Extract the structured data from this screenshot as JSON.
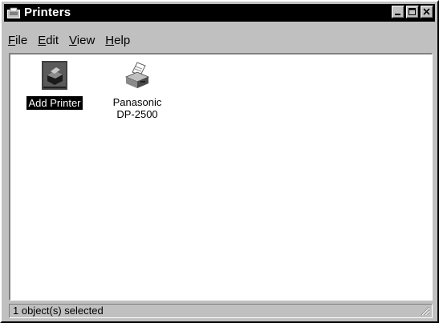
{
  "window": {
    "title": "Printers",
    "controls": {
      "minimize_icon": "minimize-icon",
      "maximize_icon": "maximize-icon",
      "close_icon": "close-icon"
    }
  },
  "menu": {
    "items": [
      {
        "label": "File",
        "accel": "F"
      },
      {
        "label": "Edit",
        "accel": "E"
      },
      {
        "label": "View",
        "accel": "V"
      },
      {
        "label": "Help",
        "accel": "H"
      }
    ]
  },
  "icons": [
    {
      "label": "Add Printer",
      "icon": "add-printer-icon",
      "selected": true
    },
    {
      "label_line1": "Panasonic",
      "label_line2": "DP-2500",
      "icon": "printer-icon",
      "selected": false
    }
  ],
  "status": {
    "text": "1 object(s) selected"
  },
  "colors": {
    "titlebar": "#000000",
    "desktop_gray": "#c0c0c0",
    "client_bg": "#ffffff"
  }
}
